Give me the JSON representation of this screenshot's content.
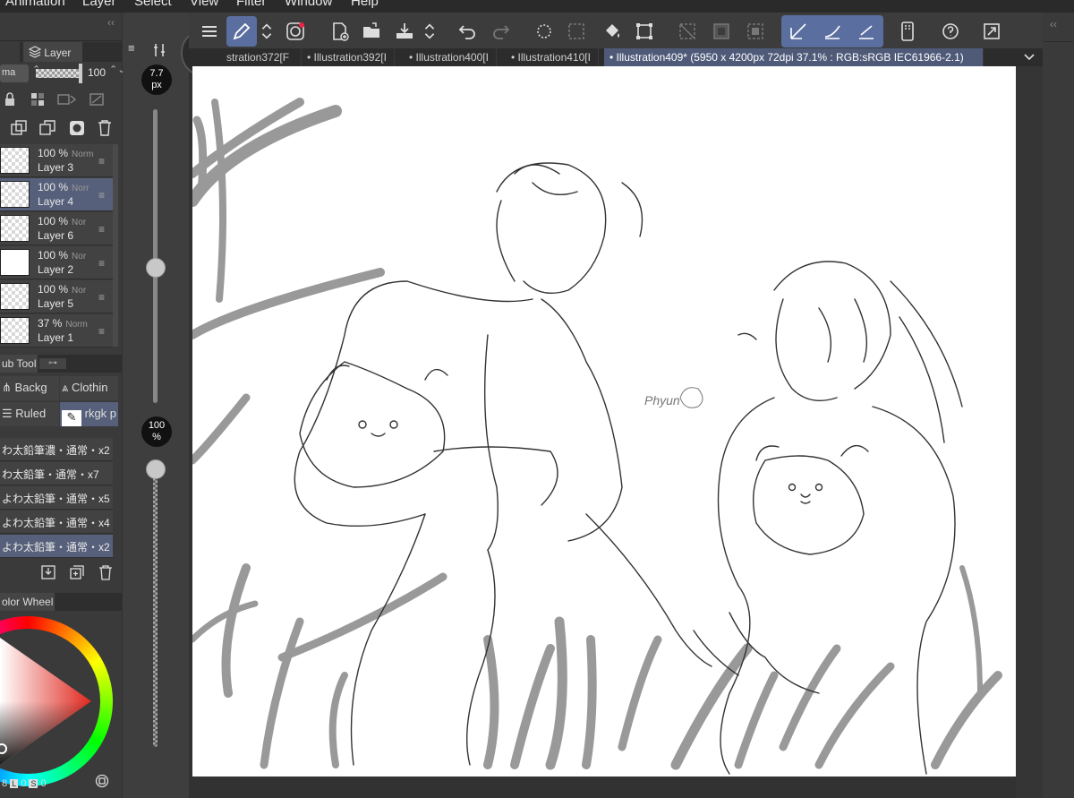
{
  "menu": [
    "Animation",
    "Layer",
    "Select",
    "View",
    "Filter",
    "Window",
    "Help"
  ],
  "left_panel": {
    "tabs": {
      "layer": "Layer"
    },
    "blend_mode": "ma",
    "opacity_value": "100",
    "layers": [
      {
        "opacity": "100 %",
        "mode": "Norm",
        "name": "Layer 3"
      },
      {
        "opacity": "100 %",
        "mode": "Norr",
        "name": "Layer 4"
      },
      {
        "opacity": "100 %",
        "mode": "Nor",
        "name": "Layer 6"
      },
      {
        "opacity": "100 %",
        "mode": "Nor",
        "name": "Layer 2"
      },
      {
        "opacity": "100 %",
        "mode": "Nor",
        "name": "Layer 5"
      },
      {
        "opacity": "37 %",
        "mode": "Norm",
        "name": "Layer 1"
      }
    ],
    "selected_layer": "Layer 4",
    "subtool_tab": "ub Tool",
    "subtool_groups": [
      "Backg",
      "Clothin",
      "Ruled",
      "rkgk p"
    ],
    "brushes": [
      "わ太鉛筆濃・通常・x2",
      "わ太鉛筆・通常・x7",
      "よわ太鉛筆・通常・x5",
      "よわ太鉛筆・通常・x4",
      "よわ太鉛筆・通常・x2"
    ],
    "color_wheel_tab": "olor Wheel",
    "color_values": [
      "8",
      "L",
      "0",
      "S",
      "0"
    ]
  },
  "slider": {
    "brush_size": "7.7",
    "brush_size_unit": "px",
    "opacity": "100",
    "opacity_unit": "%",
    "brush_size_level": 0.2,
    "opacity_level": 0.0
  },
  "tabs_collapse": "T",
  "doc_tabs": [
    {
      "label": "stration372[F",
      "active": false
    },
    {
      "label": "Illustration392[I",
      "active": false
    },
    {
      "label": "Illustration400[I",
      "active": false
    },
    {
      "label": "Illustration410[I",
      "active": false
    },
    {
      "label": "Illustration409* (5950 x 4200px 72dpi 37.1% : RGB:sRGB IEC61966-2.1)",
      "active": true
    }
  ],
  "canvas_text": "Phyun",
  "colors": {
    "accent": "#5b6ea0",
    "tab_active": "#4e5a78",
    "panel": "#3a3a3a"
  }
}
